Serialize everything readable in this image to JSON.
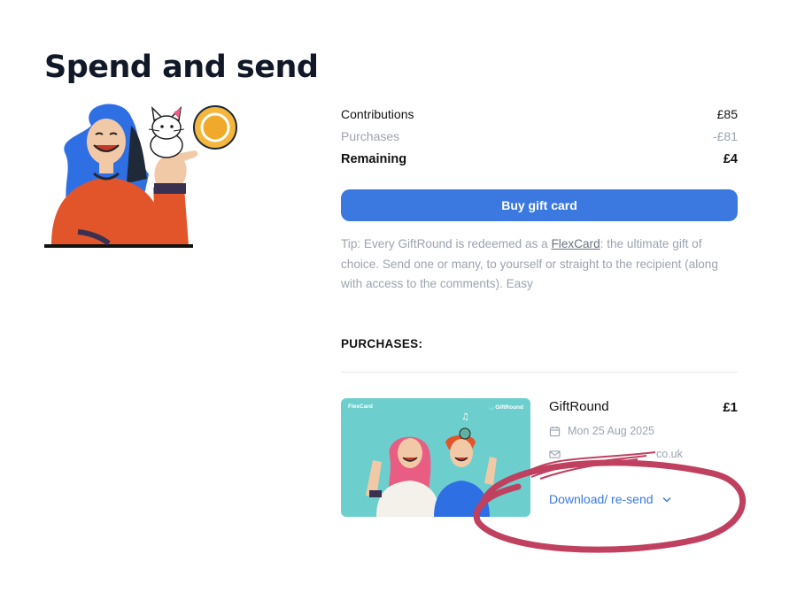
{
  "page": {
    "title": "Spend and send"
  },
  "summary": {
    "rows": [
      {
        "label": "Contributions",
        "value": "£85"
      },
      {
        "label": "Purchases",
        "value": "-£81"
      },
      {
        "label": "Remaining",
        "value": "£4"
      }
    ]
  },
  "actions": {
    "buy_label": "Buy gift card"
  },
  "tip": {
    "prefix": "Tip: Every GiftRound is redeemed as a ",
    "link": "FlexCard",
    "suffix": ": the ultimate gift of choice. Send one or many, to yourself or straight to the recipient (along with access to the comments). Easy"
  },
  "purchases": {
    "heading": "PURCHASES:",
    "items": [
      {
        "card_brand": "FlexCard",
        "card_logo": "GiftRound",
        "name": "GiftRound",
        "price": "£1",
        "date": "Mon 25 Aug 2025",
        "email_visible": "co.uk",
        "action_label": "Download/ re-send",
        "icons": {
          "date": "calendar-icon",
          "email": "mail-icon",
          "action": "chevron-down-icon"
        }
      }
    ]
  },
  "colors": {
    "accent": "#3b79e0",
    "card_bg": "#6dcfcd",
    "annotation": "#c0405f"
  }
}
